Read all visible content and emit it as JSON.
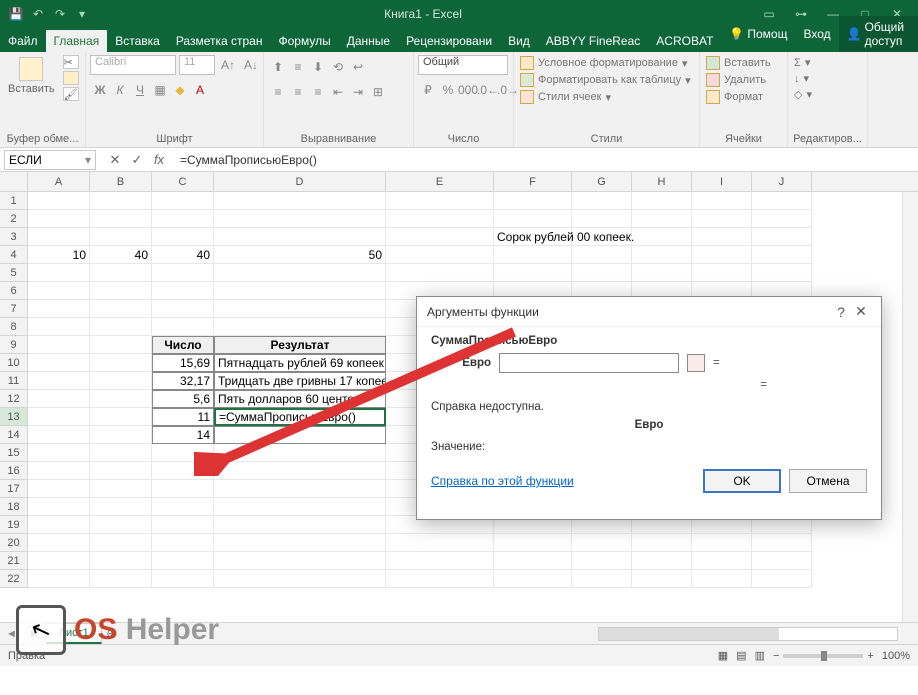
{
  "app": {
    "title": "Книга1 - Excel"
  },
  "qat": [
    "save",
    "undo",
    "redo",
    "dropdown"
  ],
  "tabs": {
    "file": "Файл",
    "items": [
      "Главная",
      "Вставка",
      "Разметка стран",
      "Формулы",
      "Данные",
      "Рецензировани",
      "Вид",
      "ABBYY FineReac",
      "ACROBAT"
    ],
    "active": 0,
    "help": "Помощ",
    "signin": "Вход",
    "share": "Общий доступ"
  },
  "ribbon": {
    "clipboard": {
      "label": "Буфер обме...",
      "paste": "Вставить"
    },
    "font": {
      "label": "Шрифт",
      "name": "Calibri",
      "size": "11"
    },
    "align": {
      "label": "Выравнивание"
    },
    "number": {
      "label": "Число",
      "format": "Общий"
    },
    "styles": {
      "label": "Стили",
      "cond": "Условное форматирование",
      "table": "Форматировать как таблицу",
      "cell": "Стили ячеек"
    },
    "cells": {
      "label": "Ячейки",
      "insert": "Вставить",
      "delete": "Удалить",
      "format": "Формат"
    },
    "editing": {
      "label": "Редактиров..."
    }
  },
  "formulaBar": {
    "name": "ЕСЛИ",
    "formula": "=СуммаПрописьюЕвро()"
  },
  "columns": [
    "A",
    "B",
    "C",
    "D",
    "E",
    "F",
    "G",
    "H",
    "I",
    "J"
  ],
  "cells": {
    "F3": "Сорок рублей  00 копеек.",
    "A4": "10",
    "B4": "40",
    "C4": "40",
    "D4": "50",
    "C9": "Число",
    "D9": "Результат",
    "C10": "15,69",
    "D10": "Пятнадцать рублей 69 копеек",
    "C11": "32,17",
    "D11": "Тридцать две гривны 17 копеек",
    "C12": "5,6",
    "D12": "Пять долларов 60 центов",
    "C13": "11",
    "D13": "=СуммаПрописьюЕвро()",
    "C14": "14"
  },
  "dialog": {
    "title": "Аргументы функции",
    "funcName": "СуммаПрописьюЕвро",
    "argLabel": "Евро",
    "eq": "=",
    "eq2": "=",
    "help": "Справка недоступна.",
    "argDesc": "Евро",
    "valueLabel": "Значение:",
    "link": "Справка по этой функции",
    "ok": "OK",
    "cancel": "Отмена"
  },
  "sheet": {
    "name": "Лист1"
  },
  "status": {
    "left": "Правка",
    "zoom": "100%"
  },
  "logo": {
    "os": "OS",
    "helper": "Helper"
  }
}
